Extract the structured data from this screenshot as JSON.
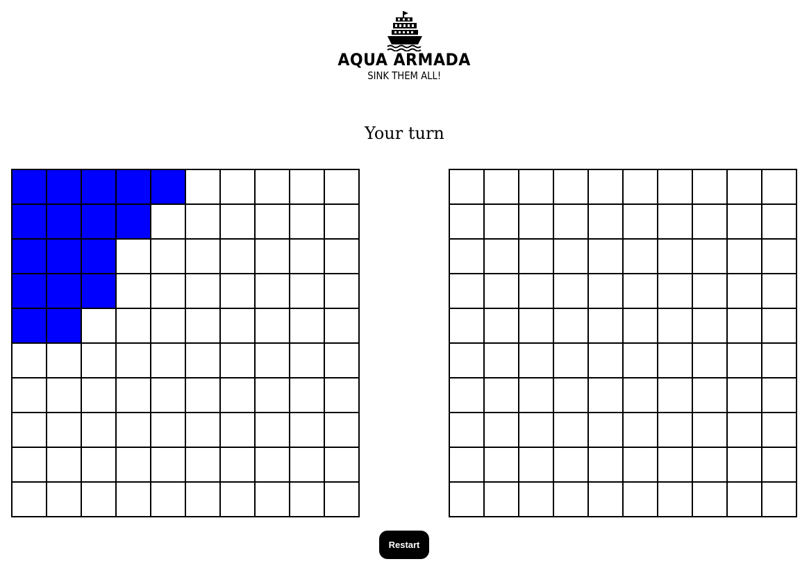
{
  "header": {
    "logo_icon": "ship-icon",
    "title": "AQUA ARMADA",
    "tagline": "SINK THEM ALL!"
  },
  "status_text": "Your turn",
  "boards": {
    "size": 10,
    "ship_color": "#0000ff",
    "empty_color": "#ffffff",
    "player": {
      "ship_cells": [
        [
          0,
          0
        ],
        [
          0,
          1
        ],
        [
          0,
          2
        ],
        [
          0,
          3
        ],
        [
          0,
          4
        ],
        [
          1,
          0
        ],
        [
          1,
          1
        ],
        [
          1,
          2
        ],
        [
          1,
          3
        ],
        [
          2,
          0
        ],
        [
          2,
          1
        ],
        [
          2,
          2
        ],
        [
          3,
          0
        ],
        [
          3,
          1
        ],
        [
          3,
          2
        ],
        [
          4,
          0
        ],
        [
          4,
          1
        ]
      ]
    },
    "enemy": {
      "ship_cells": []
    }
  },
  "controls": {
    "restart_label": "Restart"
  }
}
